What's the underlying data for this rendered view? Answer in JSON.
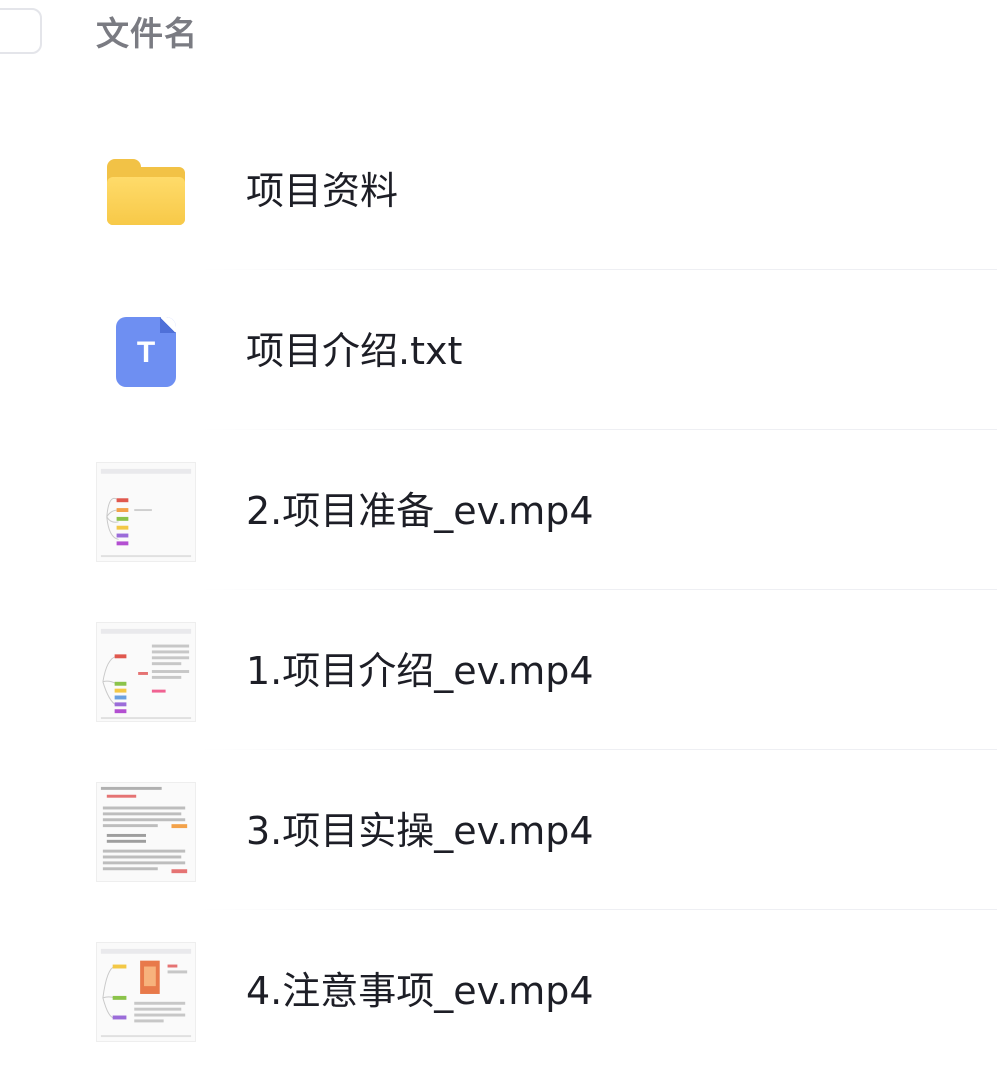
{
  "header": {
    "column_label": "文件名"
  },
  "files": [
    {
      "name": "项目资料",
      "icon": "folder-icon"
    },
    {
      "name": "项目介绍.txt",
      "icon": "text-file-icon",
      "icon_glyph": "T"
    },
    {
      "name": "2.项目准备_ev.mp4",
      "icon": "video-thumbnail"
    },
    {
      "name": "1.项目介绍_ev.mp4",
      "icon": "video-thumbnail"
    },
    {
      "name": "3.项目实操_ev.mp4",
      "icon": "video-thumbnail"
    },
    {
      "name": "4.注意事项_ev.mp4",
      "icon": "video-thumbnail"
    }
  ],
  "colors": {
    "folder": "#f7c948",
    "text_file": "#6e8ff2",
    "name_text": "#1d1e26",
    "header_text": "#7a7b82"
  }
}
